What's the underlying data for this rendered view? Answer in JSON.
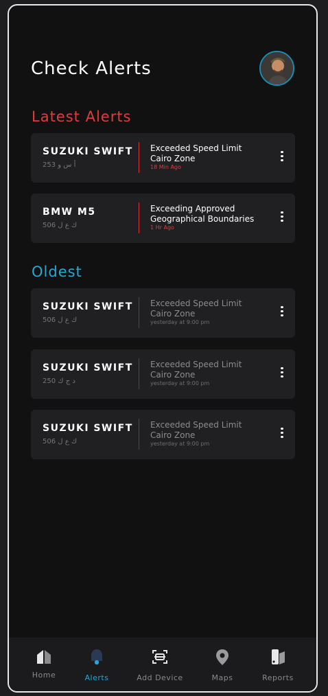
{
  "page": {
    "title": "Check Alerts"
  },
  "sections": {
    "latest": "Latest Alerts",
    "oldest": "Oldest"
  },
  "latest_alerts": [
    {
      "car": "SUZUKI SWIFT",
      "plate": "أ س و 253",
      "line1": "Exceeded Speed Limit",
      "line2": "Cairo Zone",
      "time": "18 Min Ago"
    },
    {
      "car": "BMW M5",
      "plate": "ك ع ل 506",
      "line1": "Exceeding Approved",
      "line2": "Geographical Boundaries",
      "time": "1 Hr Ago"
    }
  ],
  "oldest_alerts": [
    {
      "car": "SUZUKI SWIFT",
      "plate": "ك ع ل 506",
      "line1": "Exceeded Speed Limit",
      "line2": "Cairo Zone",
      "time": "yesterday at 9:00 pm"
    },
    {
      "car": "SUZUKI SWIFT",
      "plate": "د ج ك 250",
      "line1": "Exceeded Speed Limit",
      "line2": "Cairo Zone",
      "time": "yesterday at 9:00 pm"
    },
    {
      "car": "SUZUKI SWIFT",
      "plate": "ك ع ل 506",
      "line1": "Exceeded Speed Limit",
      "line2": "Cairo Zone",
      "time": "yesterday at 9:00 pm"
    }
  ],
  "tabs": [
    {
      "label": "Home",
      "icon": "home-icon"
    },
    {
      "label": "Alerts",
      "icon": "bell-icon",
      "active": true
    },
    {
      "label": "Add Device",
      "icon": "scan-icon"
    },
    {
      "label": "Maps",
      "icon": "map-pin-icon"
    },
    {
      "label": "Reports",
      "icon": "reports-icon"
    }
  ],
  "colors": {
    "accent_red": "#e23b3b",
    "accent_blue": "#25a9d4",
    "card_bg": "#202023",
    "app_bg": "#111111"
  }
}
